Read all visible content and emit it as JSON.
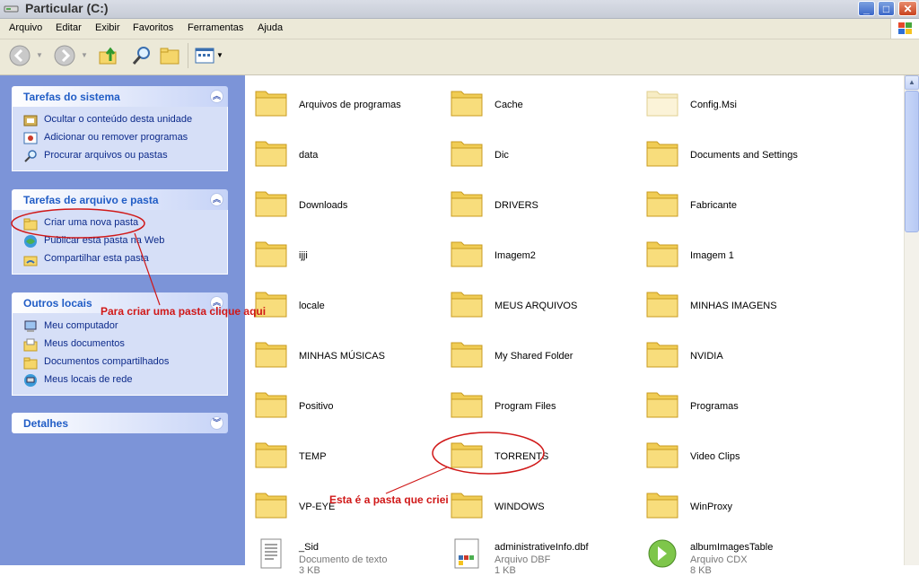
{
  "window": {
    "title": "Particular (C:)",
    "min_label": "_",
    "max_label": "□",
    "close_label": "✕"
  },
  "menu": [
    "Arquivo",
    "Editar",
    "Exibir",
    "Favoritos",
    "Ferramentas",
    "Ajuda"
  ],
  "icons": {
    "back": "back-arrow-icon",
    "forward": "forward-arrow-icon",
    "up": "folder-up-icon",
    "search": "search-icon",
    "folders": "folders-icon",
    "views": "views-icon"
  },
  "sidebar": {
    "system": {
      "title": "Tarefas do sistema",
      "items": [
        "Ocultar o conteúdo desta unidade",
        "Adicionar ou remover programas",
        "Procurar arquivos ou pastas"
      ]
    },
    "file": {
      "title": "Tarefas de arquivo e pasta",
      "items": [
        "Criar uma nova pasta",
        "Publicar esta pasta na Web",
        "Compartilhar esta pasta"
      ]
    },
    "other": {
      "title": "Outros locais",
      "items": [
        "Meu computador",
        "Meus documentos",
        "Documentos compartilhados",
        "Meus locais de rede"
      ]
    },
    "details": {
      "title": "Detalhes"
    }
  },
  "folders": [
    [
      "Arquivos de programas",
      "Cache",
      "Config.Msi"
    ],
    [
      "data",
      "Dic",
      "Documents and Settings"
    ],
    [
      "Downloads",
      "DRIVERS",
      "Fabricante"
    ],
    [
      "ijji",
      "Imagem2",
      "Imagem 1"
    ],
    [
      "locale",
      "MEUS ARQUIVOS",
      "MINHAS IMAGENS"
    ],
    [
      "MINHAS MÚSICAS",
      "My Shared Folder",
      "NVIDIA"
    ],
    [
      "Positivo",
      "Program Files",
      "Programas"
    ],
    [
      "TEMP",
      "TORRENTS",
      "Video Clips"
    ],
    [
      "VP-EYE",
      "WINDOWS",
      "WinProxy"
    ]
  ],
  "files": [
    {
      "name": "_Sid",
      "type": "Documento de texto",
      "size": "3 KB"
    },
    {
      "name": "administrativeInfo.dbf",
      "type": "Arquivo DBF",
      "size": "1 KB"
    },
    {
      "name": "albumImagesTable",
      "type": "Arquivo CDX",
      "size": "8 KB"
    }
  ],
  "annotations": {
    "create": "Para criar uma pasta  clique aqui",
    "created": "Esta é a pasta que criei"
  },
  "colors": {
    "annotation": "#d01818",
    "folder": "#f5d66a",
    "sidebar": "#7c94d8"
  }
}
